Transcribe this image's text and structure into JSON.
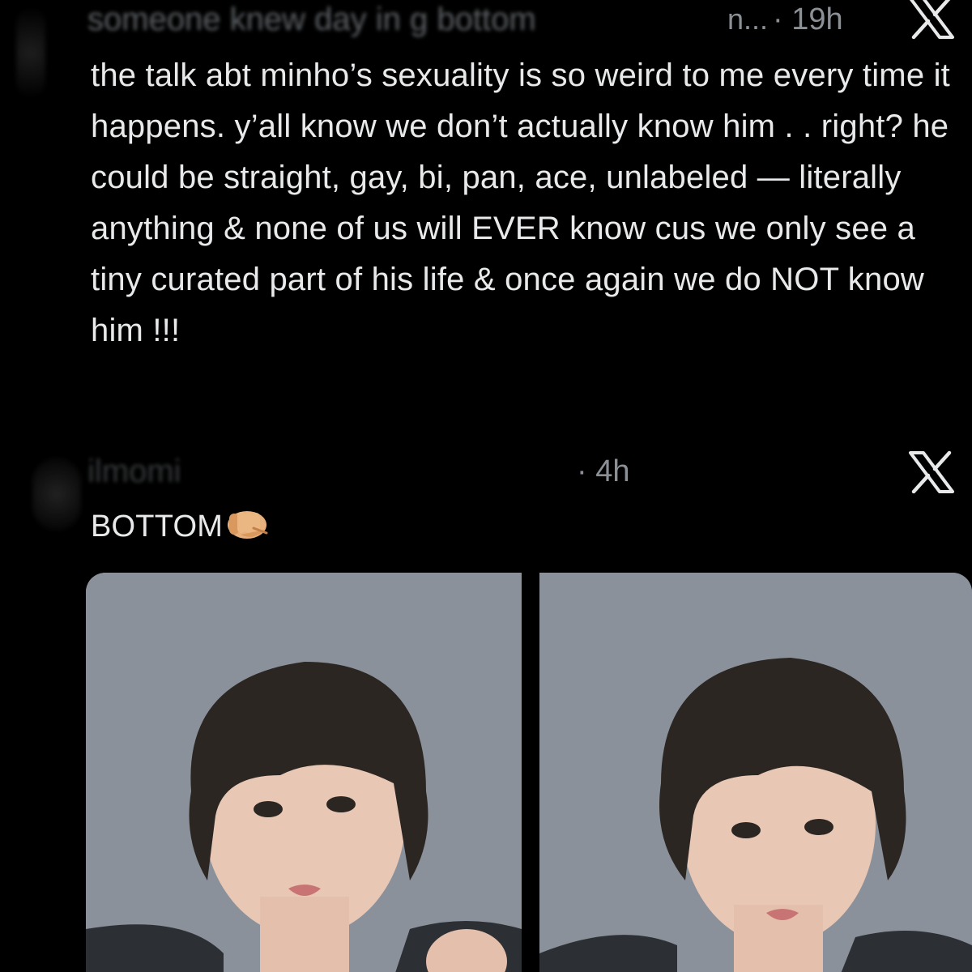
{
  "tweets": [
    {
      "handle_blurred": "someone knew day in g bottom",
      "handle_tail": "n...",
      "time": "· 19h",
      "platform_icon": "x-logo-icon",
      "text": "the talk abt minho’s sexuality is so weird to me every time it happens. y’all know we don’t actually know him . . right? he could be straight, gay, bi, pan, ace, unlabeled — literally anything & none of us will EVER know cus we only see a tiny curated part of his life & once again we do NOT know him !!!"
    },
    {
      "handle_blurred": "ilmomi",
      "time": "· 4h",
      "platform_icon": "x-logo-icon",
      "text": "BOTTOM",
      "emoji": "fist-pointing-emoji",
      "media": [
        "photo",
        "photo"
      ]
    }
  ],
  "colors": {
    "background": "#000000",
    "text": "#e7e9ea",
    "muted": "#8b9096",
    "photo_background": "#8d949e"
  }
}
